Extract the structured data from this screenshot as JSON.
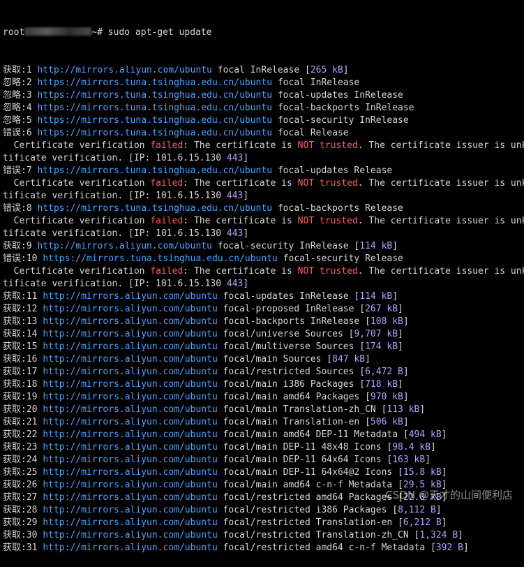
{
  "prompt": {
    "user": "root",
    "path": "~#",
    "command": "sudo apt-get update"
  },
  "cert_error": {
    "lead": "  Certificate verification ",
    "failed": "failed",
    "mid": ": The certificate is ",
    "not": "NOT",
    "trusted": "trusted",
    "tail": ". The certificate issuer is unk",
    "wrap_lead": "tificate verification. [IP: ",
    "ip": "101.6.15.130",
    "port": "443",
    "wrap_end": "]"
  },
  "lines": [
    {
      "kind": "entry",
      "label": "获取:1",
      "url": "http://mirrors.aliyun.com/ubuntu",
      "text": "focal InRelease",
      "size": "265 kB"
    },
    {
      "kind": "entry",
      "label": "忽略:2",
      "url": "https://mirrors.tuna.tsinghua.edu.cn/ubuntu",
      "text": "focal InRelease"
    },
    {
      "kind": "entry",
      "label": "忽略:3",
      "url": "https://mirrors.tuna.tsinghua.edu.cn/ubuntu",
      "text": "focal-updates InRelease"
    },
    {
      "kind": "entry",
      "label": "忽略:4",
      "url": "https://mirrors.tuna.tsinghua.edu.cn/ubuntu",
      "text": "focal-backports InRelease"
    },
    {
      "kind": "entry",
      "label": "忽略:5",
      "url": "https://mirrors.tuna.tsinghua.edu.cn/ubuntu",
      "text": "focal-security InRelease"
    },
    {
      "kind": "entry",
      "label": "错误:6",
      "url": "https://mirrors.tuna.tsinghua.edu.cn/ubuntu",
      "text": "focal Release"
    },
    {
      "kind": "cert"
    },
    {
      "kind": "wrap"
    },
    {
      "kind": "entry",
      "label": "错误:7",
      "url": "https://mirrors.tuna.tsinghua.edu.cn/ubuntu",
      "text": "focal-updates Release"
    },
    {
      "kind": "cert"
    },
    {
      "kind": "wrap"
    },
    {
      "kind": "entry",
      "label": "错误:8",
      "url": "https://mirrors.tuna.tsinghua.edu.cn/ubuntu",
      "text": "focal-backports Release"
    },
    {
      "kind": "cert"
    },
    {
      "kind": "wrap"
    },
    {
      "kind": "entry",
      "label": "获取:9",
      "url": "http://mirrors.aliyun.com/ubuntu",
      "text": "focal-security InRelease",
      "size": "114 kB"
    },
    {
      "kind": "entry",
      "label": "错误:10",
      "url": "https://mirrors.tuna.tsinghua.edu.cn/ubuntu",
      "text": "focal-security Release"
    },
    {
      "kind": "cert"
    },
    {
      "kind": "wrap"
    },
    {
      "kind": "entry",
      "label": "获取:11",
      "url": "http://mirrors.aliyun.com/ubuntu",
      "text": "focal-updates InRelease",
      "size": "114 kB"
    },
    {
      "kind": "entry",
      "label": "获取:12",
      "url": "http://mirrors.aliyun.com/ubuntu",
      "text": "focal-proposed InRelease",
      "size": "267 kB"
    },
    {
      "kind": "entry",
      "label": "获取:13",
      "url": "http://mirrors.aliyun.com/ubuntu",
      "text": "focal-backports InRelease",
      "size": "108 kB"
    },
    {
      "kind": "entry",
      "label": "获取:14",
      "url": "http://mirrors.aliyun.com/ubuntu",
      "text": "focal/universe Sources",
      "size": "9,707 kB"
    },
    {
      "kind": "entry",
      "label": "获取:15",
      "url": "http://mirrors.aliyun.com/ubuntu",
      "text": "focal/multiverse Sources",
      "size": "174 kB"
    },
    {
      "kind": "entry",
      "label": "获取:16",
      "url": "http://mirrors.aliyun.com/ubuntu",
      "text": "focal/main Sources",
      "size": "847 kB"
    },
    {
      "kind": "entry",
      "label": "获取:17",
      "url": "http://mirrors.aliyun.com/ubuntu",
      "text": "focal/restricted Sources",
      "size": "6,472 B"
    },
    {
      "kind": "entry",
      "label": "获取:18",
      "url": "http://mirrors.aliyun.com/ubuntu",
      "text": "focal/main i386 Packages",
      "size": "718 kB"
    },
    {
      "kind": "entry",
      "label": "获取:19",
      "url": "http://mirrors.aliyun.com/ubuntu",
      "text": "focal/main amd64 Packages",
      "size": "970 kB"
    },
    {
      "kind": "entry",
      "label": "获取:20",
      "url": "http://mirrors.aliyun.com/ubuntu",
      "text": "focal/main Translation-zh_CN",
      "size": "113 kB"
    },
    {
      "kind": "entry",
      "label": "获取:21",
      "url": "http://mirrors.aliyun.com/ubuntu",
      "text": "focal/main Translation-en",
      "size": "506 kB"
    },
    {
      "kind": "entry",
      "label": "获取:22",
      "url": "http://mirrors.aliyun.com/ubuntu",
      "text": "focal/main amd64 DEP-11 Metadata",
      "size": "494 kB"
    },
    {
      "kind": "entry",
      "label": "获取:23",
      "url": "http://mirrors.aliyun.com/ubuntu",
      "text": "focal/main DEP-11 48x48 Icons",
      "size": "98.4 kB"
    },
    {
      "kind": "entry",
      "label": "获取:24",
      "url": "http://mirrors.aliyun.com/ubuntu",
      "text": "focal/main DEP-11 64x64 Icons",
      "size": "163 kB"
    },
    {
      "kind": "entry",
      "label": "获取:25",
      "url": "http://mirrors.aliyun.com/ubuntu",
      "text": "focal/main DEP-11 64x64@2 Icons",
      "size": "15.8 kB"
    },
    {
      "kind": "entry",
      "label": "获取:26",
      "url": "http://mirrors.aliyun.com/ubuntu",
      "text": "focal/main amd64 c-n-f Metadata",
      "size": "29.5 kB"
    },
    {
      "kind": "entry",
      "label": "获取:27",
      "url": "http://mirrors.aliyun.com/ubuntu",
      "text": "focal/restricted amd64 Packages",
      "size": "22.0 kB"
    },
    {
      "kind": "entry",
      "label": "获取:28",
      "url": "http://mirrors.aliyun.com/ubuntu",
      "text": "focal/restricted i386 Packages",
      "size": "8,112 B"
    },
    {
      "kind": "entry",
      "label": "获取:29",
      "url": "http://mirrors.aliyun.com/ubuntu",
      "text": "focal/restricted Translation-en",
      "size": "6,212 B"
    },
    {
      "kind": "entry",
      "label": "获取:30",
      "url": "http://mirrors.aliyun.com/ubuntu",
      "text": "focal/restricted Translation-zh_CN",
      "size": "1,324 B"
    },
    {
      "kind": "entry",
      "label": "获取:31",
      "url": "http://mirrors.aliyun.com/ubuntu",
      "text": "focal/restricted amd64 c-n-f Metadata",
      "size": "392 B"
    }
  ],
  "watermark": "CSDN @天才的山间便利店",
  "colors": {
    "background": "#000000",
    "text": "#d6d6d6",
    "url": "#48a4ff",
    "size": "#b5a1ff",
    "error": "#ff5c5c"
  }
}
